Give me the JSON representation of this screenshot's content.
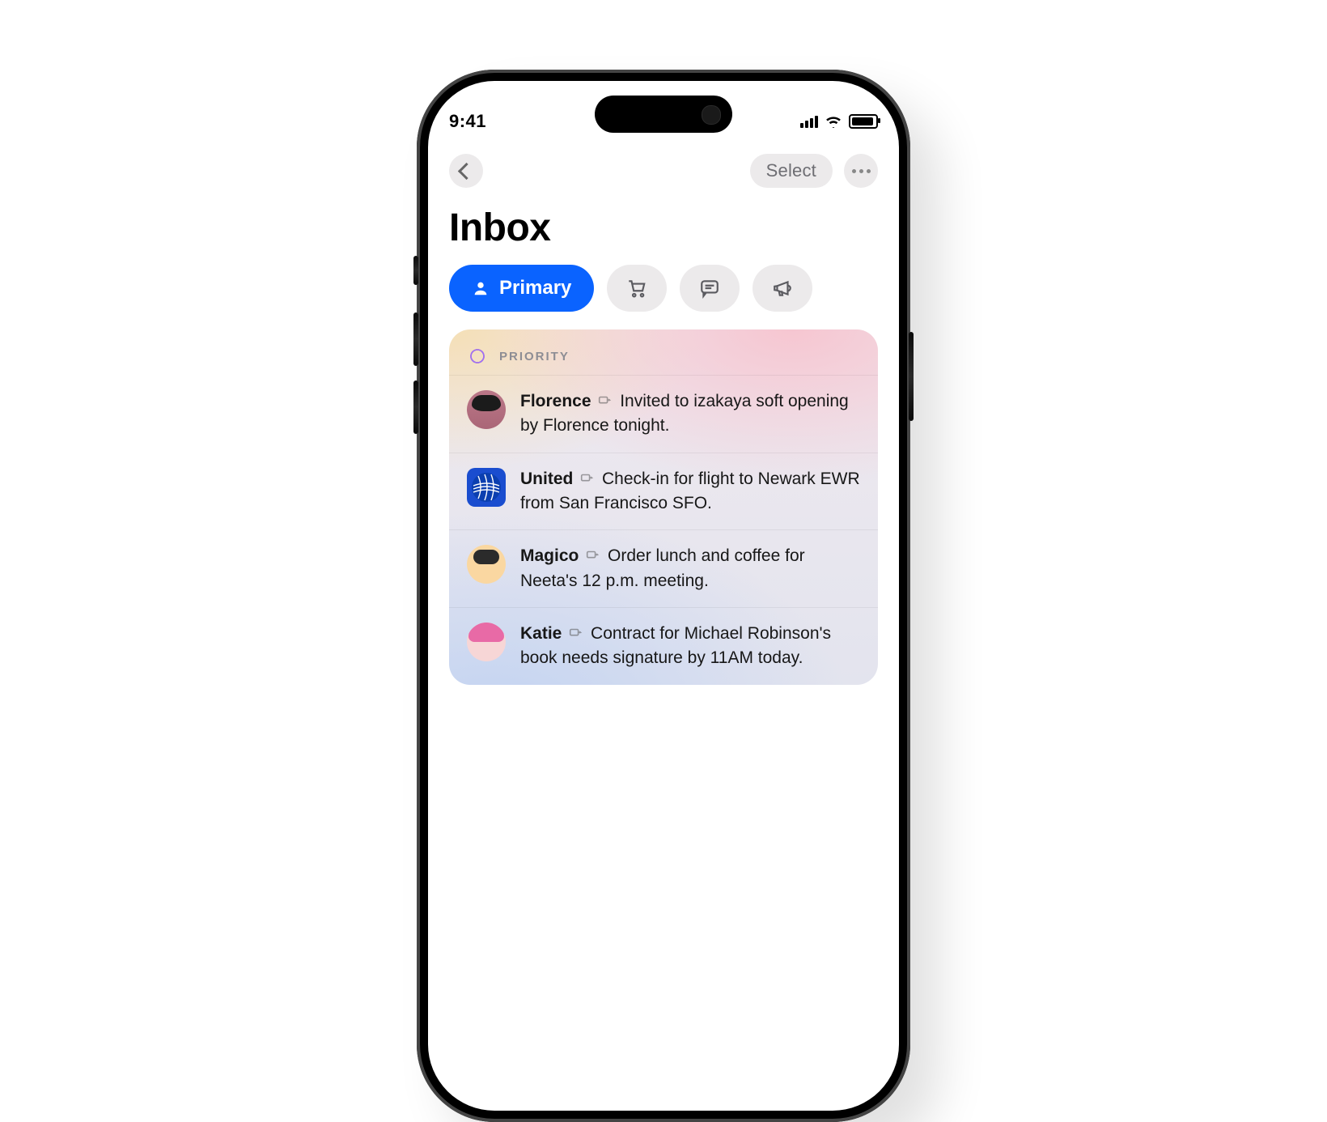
{
  "status": {
    "time": "9:41"
  },
  "nav": {
    "select_label": "Select"
  },
  "page_title": "Inbox",
  "tabs": {
    "primary_label": "Primary",
    "icons": [
      "person",
      "cart",
      "message",
      "megaphone"
    ]
  },
  "priority": {
    "header": "PRIORITY",
    "items": [
      {
        "sender": "Florence",
        "summary": "Invited to izakaya soft opening by Florence tonight."
      },
      {
        "sender": "United",
        "summary": "Check-in for flight to Newark EWR from San Francisco SFO."
      },
      {
        "sender": "Magico",
        "summary": "Order lunch and coffee for Neeta's 12 p.m. meeting."
      },
      {
        "sender": "Katie",
        "summary": "Contract for Michael Robinson's book needs signature by 11AM today."
      }
    ]
  }
}
